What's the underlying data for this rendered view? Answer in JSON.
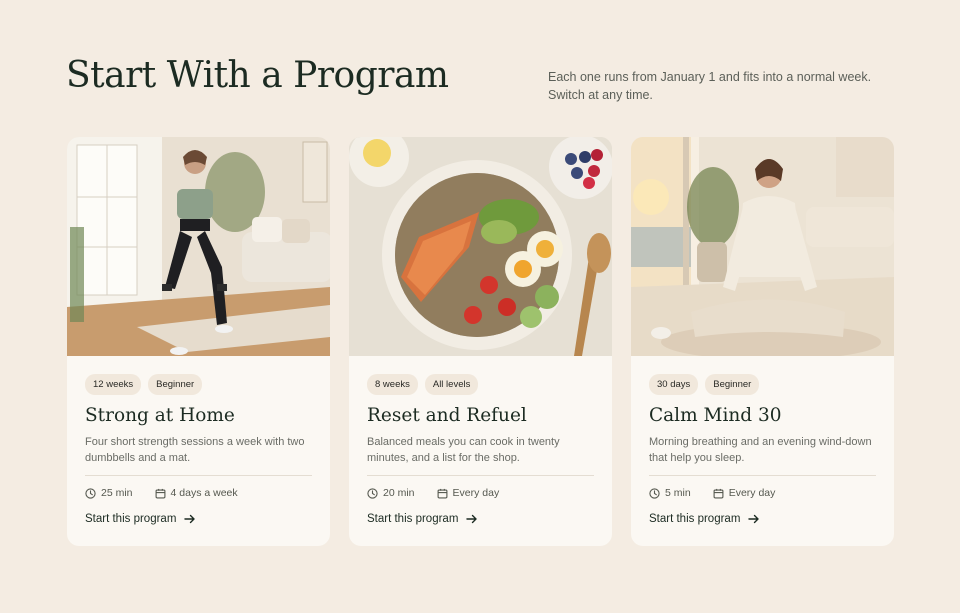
{
  "header": {
    "title": "Start With a Program",
    "subtitle": "Each one runs from January 1 and fits into a normal week. Switch at any time."
  },
  "cards": [
    {
      "tags": [
        "12 weeks",
        "Beginner"
      ],
      "title": "Strong at Home",
      "description": "Four short strength sessions a week with two dumbbells and a mat.",
      "duration": "25 min",
      "frequency": "4 days a week",
      "cta": "Start this program"
    },
    {
      "tags": [
        "8 weeks",
        "All levels"
      ],
      "title": "Reset and Refuel",
      "description": "Balanced meals you can cook in twenty minutes, and a list for the shop.",
      "duration": "20 min",
      "frequency": "Every day",
      "cta": "Start this program"
    },
    {
      "tags": [
        "30 days",
        "Beginner"
      ],
      "title": "Calm Mind 30",
      "description": "Morning breathing and an evening wind-down that help you sleep.",
      "duration": "5 min",
      "frequency": "Every day",
      "cta": "Start this program"
    }
  ],
  "icons": {
    "duration": "clock-icon",
    "frequency": "calendar-icon",
    "cta": "arrow-right-icon"
  },
  "colors": {
    "background": "#f4ece2",
    "card": "#fbf8f3",
    "tag": "#f1e8dc",
    "heading": "#1c2b22"
  }
}
